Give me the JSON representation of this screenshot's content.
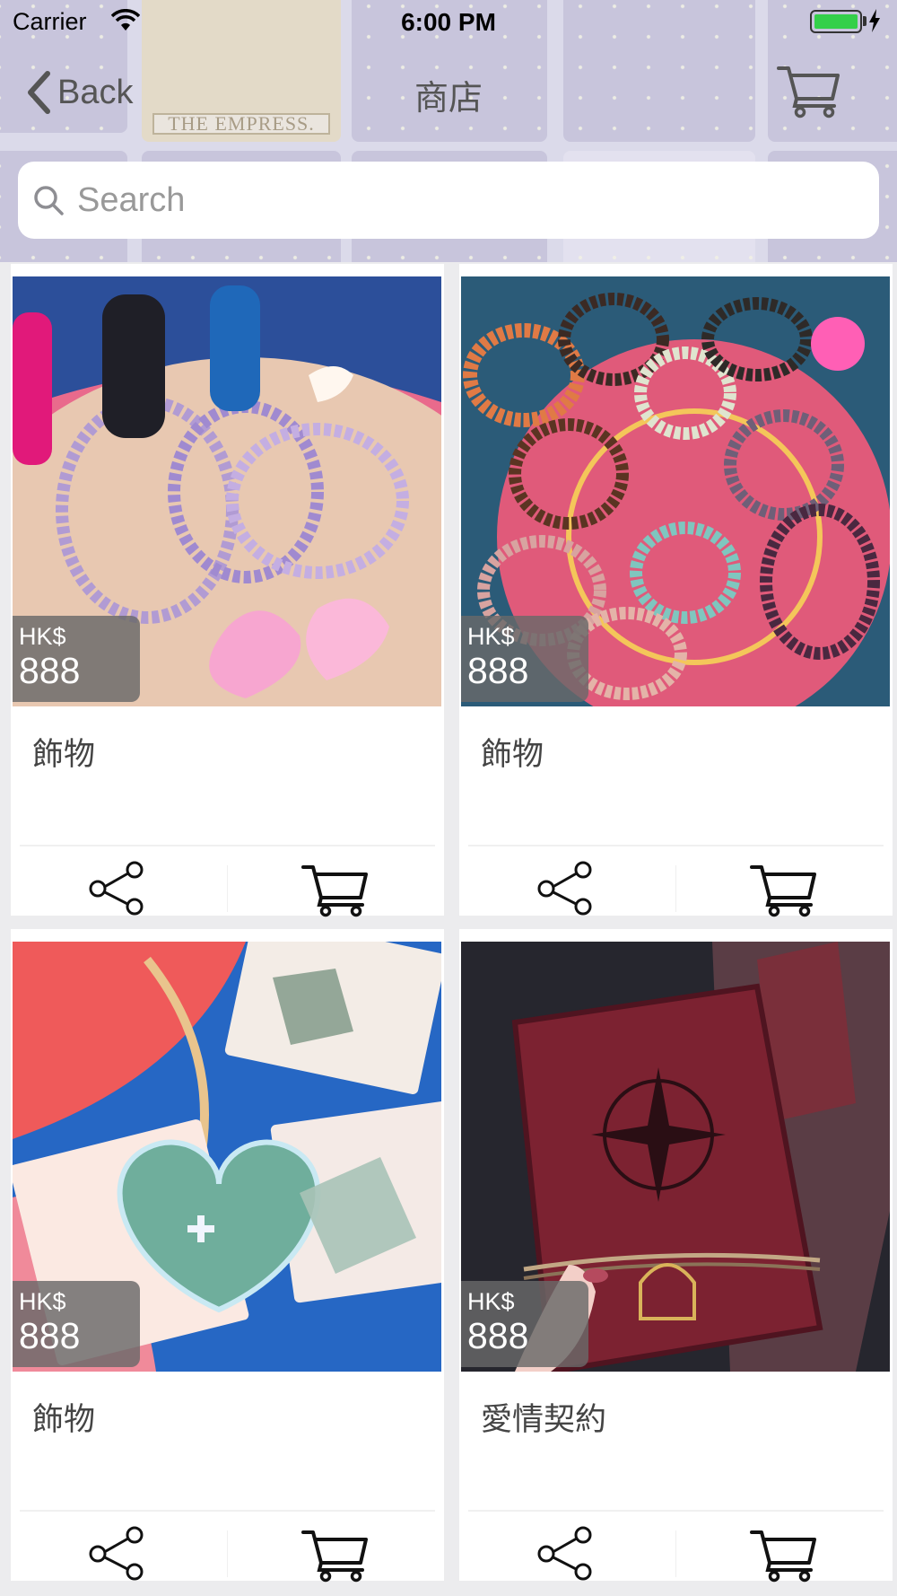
{
  "status_bar": {
    "carrier": "Carrier",
    "time": "6:00 PM"
  },
  "header_background": {
    "card_caption": "THE EMPRESS."
  },
  "nav": {
    "back_label": "Back",
    "title": "商店"
  },
  "search": {
    "placeholder": "Search"
  },
  "products": [
    {
      "name": "飾物",
      "currency": "HK$",
      "price": "888",
      "photo": "bracelets-with-toy-horses"
    },
    {
      "name": "飾物",
      "currency": "HK$",
      "price": "888",
      "photo": "colorful-bead-bracelets"
    },
    {
      "name": "飾物",
      "currency": "HK$",
      "price": "888",
      "photo": "heart-crystal-box"
    },
    {
      "name": "愛情契約",
      "currency": "HK$",
      "price": "888",
      "photo": "compass-leather-notebook"
    }
  ],
  "colors": {
    "accent_green": "#34d04a",
    "price_badge": "#696969",
    "text": "#444444"
  }
}
